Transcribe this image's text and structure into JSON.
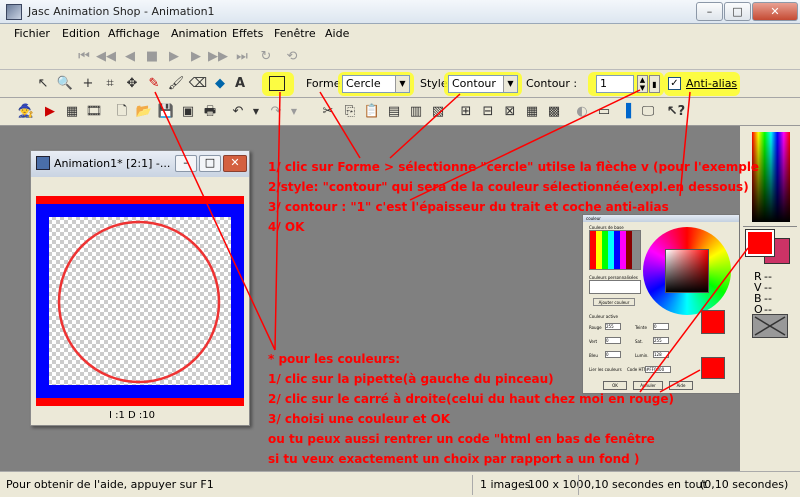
{
  "window": {
    "title": "Jasc Animation Shop - Animation1"
  },
  "menu": [
    "Fichier",
    "Edition",
    "Affichage",
    "Animation",
    "Effets",
    "Fenêtre",
    "Aide"
  ],
  "tools": {
    "forme_label": "Forme :",
    "forme_value": "Cercle",
    "style_label": "Style :",
    "style_value": "Contour",
    "contour_label": "Contour :",
    "contour_value": "1",
    "antialias_label": "Anti-alias"
  },
  "document": {
    "title": "Animation1* [2:1] -...",
    "frame_info": "I :1  D :10"
  },
  "right_panel": {
    "labels": [
      "R",
      "V",
      "B",
      "O"
    ],
    "r_val": "--",
    "v_val": "--",
    "b_val": "--",
    "o_val": "--"
  },
  "color_dialog": {
    "title": "couleur",
    "basic": "Couleurs de base",
    "custom": "Couleurs personnalisées",
    "add": "Ajouter couleur",
    "active": "Couleur active",
    "rouge": "Rouge",
    "vert": "Vert",
    "bleu": "Bleu",
    "teinte": "Teinte",
    "sat": "Sat.",
    "lum": "Lumin.",
    "html": "Lier les couleurs",
    "code": "Code HTML",
    "html_val": "#FF0000",
    "ok": "OK",
    "cancel": "Annuler",
    "help": "Aide"
  },
  "status": {
    "help": "Pour obtenir de l'aide, appuyer sur F1",
    "images": "1 images",
    "size": "100 x 100",
    "time": "0,10 secondes en tout",
    "time2": "(0,10 secondes)"
  },
  "annotations": {
    "step1": "1/ clic sur Forme > sélectionne \"cercle\" utilse la flèche v (pour l'exemple",
    "step2": "2/style: \"contour\" qui sera de la couleur sélectionnée(expl.en dessous)",
    "step3": "3/ contour : \"1\" c'est l'épaisseur du trait et coche anti-alias",
    "step4": "4/ OK",
    "colors_title": "* pour les couleurs:",
    "c1": "1/ clic sur la pipette(à gauche du pinceau)",
    "c2": "2/ clic sur le carré à droite(celui du haut chez moi en rouge)",
    "c3": "3/ choisi une couleur et OK",
    "c4": " ou tu peux aussi rentrer un code \"html en bas de fenêtre",
    "c5": "si tu veux exactement un choix par rapport a un fond )"
  },
  "colors": {
    "annot": "#ff0000",
    "fg": "#ff0000",
    "bg": "#cc3366",
    "frame_blue": "#0000ff"
  }
}
